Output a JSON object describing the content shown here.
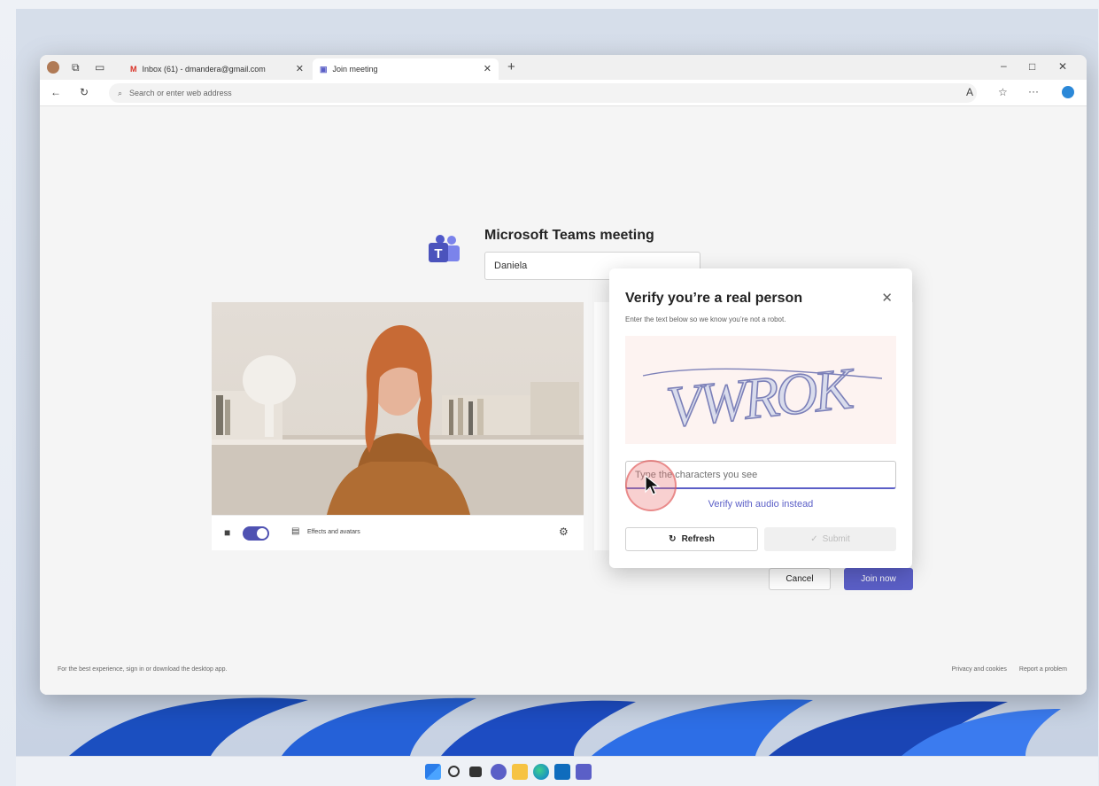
{
  "browser": {
    "tabs": [
      {
        "label": "Inbox (61) - dmandera@gmail.com",
        "icon": "gmail-icon"
      },
      {
        "label": "Join meeting",
        "icon": "teams-icon"
      }
    ],
    "address_placeholder": "Search or enter web address",
    "window_controls": [
      "minimize",
      "maximize",
      "close"
    ]
  },
  "meeting": {
    "title": "Microsoft Teams meeting",
    "name_value": "Daniela",
    "effects_label": "Effects and avatars",
    "cancel_label": "Cancel",
    "join_label": "Join now",
    "footer_left": "For the best experience, sign in or download the desktop app.",
    "footer_privacy": "Privacy and cookies",
    "footer_report": "Report a problem"
  },
  "captcha_dialog": {
    "title": "Verify you’re a real person",
    "subtitle": "Enter the text below so we know you’re not a robot.",
    "captcha_text": "VWROK",
    "input_placeholder": "Type the characters you see",
    "audio_link": "Verify with audio instead",
    "refresh_label": "Refresh",
    "submit_label": "Submit"
  },
  "colors": {
    "accent": "#5b5fc7",
    "dialog_bg": "#ffffff",
    "captcha_bg": "#fdf3f1"
  },
  "taskbar": {
    "icons": [
      "start-icon",
      "search-icon",
      "taskview-icon",
      "chat-icon",
      "file-explorer-icon",
      "edge-icon",
      "store-icon",
      "teams-icon"
    ]
  }
}
